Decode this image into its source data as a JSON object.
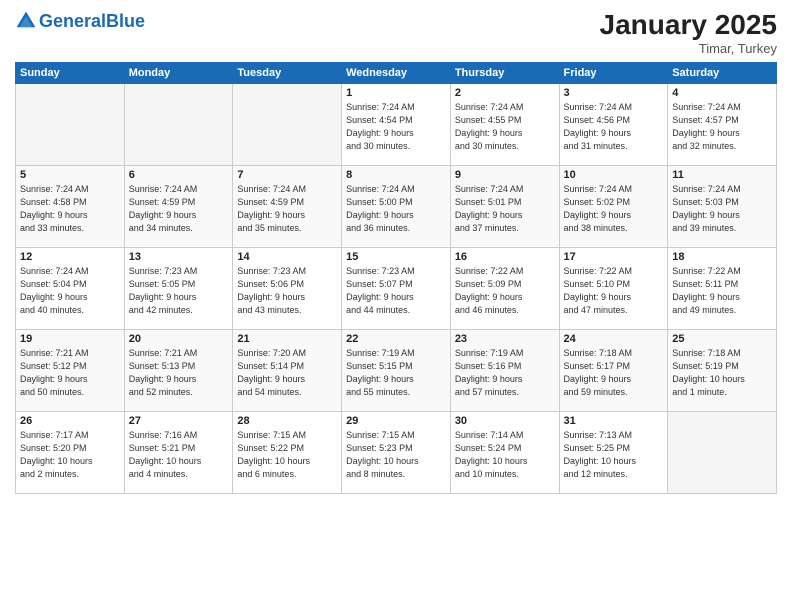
{
  "header": {
    "logo_general": "General",
    "logo_blue": "Blue",
    "month": "January 2025",
    "location": "Timar, Turkey"
  },
  "days_of_week": [
    "Sunday",
    "Monday",
    "Tuesday",
    "Wednesday",
    "Thursday",
    "Friday",
    "Saturday"
  ],
  "weeks": [
    [
      {
        "num": "",
        "info": ""
      },
      {
        "num": "",
        "info": ""
      },
      {
        "num": "",
        "info": ""
      },
      {
        "num": "1",
        "info": "Sunrise: 7:24 AM\nSunset: 4:54 PM\nDaylight: 9 hours\nand 30 minutes."
      },
      {
        "num": "2",
        "info": "Sunrise: 7:24 AM\nSunset: 4:55 PM\nDaylight: 9 hours\nand 30 minutes."
      },
      {
        "num": "3",
        "info": "Sunrise: 7:24 AM\nSunset: 4:56 PM\nDaylight: 9 hours\nand 31 minutes."
      },
      {
        "num": "4",
        "info": "Sunrise: 7:24 AM\nSunset: 4:57 PM\nDaylight: 9 hours\nand 32 minutes."
      }
    ],
    [
      {
        "num": "5",
        "info": "Sunrise: 7:24 AM\nSunset: 4:58 PM\nDaylight: 9 hours\nand 33 minutes."
      },
      {
        "num": "6",
        "info": "Sunrise: 7:24 AM\nSunset: 4:59 PM\nDaylight: 9 hours\nand 34 minutes."
      },
      {
        "num": "7",
        "info": "Sunrise: 7:24 AM\nSunset: 4:59 PM\nDaylight: 9 hours\nand 35 minutes."
      },
      {
        "num": "8",
        "info": "Sunrise: 7:24 AM\nSunset: 5:00 PM\nDaylight: 9 hours\nand 36 minutes."
      },
      {
        "num": "9",
        "info": "Sunrise: 7:24 AM\nSunset: 5:01 PM\nDaylight: 9 hours\nand 37 minutes."
      },
      {
        "num": "10",
        "info": "Sunrise: 7:24 AM\nSunset: 5:02 PM\nDaylight: 9 hours\nand 38 minutes."
      },
      {
        "num": "11",
        "info": "Sunrise: 7:24 AM\nSunset: 5:03 PM\nDaylight: 9 hours\nand 39 minutes."
      }
    ],
    [
      {
        "num": "12",
        "info": "Sunrise: 7:24 AM\nSunset: 5:04 PM\nDaylight: 9 hours\nand 40 minutes."
      },
      {
        "num": "13",
        "info": "Sunrise: 7:23 AM\nSunset: 5:05 PM\nDaylight: 9 hours\nand 42 minutes."
      },
      {
        "num": "14",
        "info": "Sunrise: 7:23 AM\nSunset: 5:06 PM\nDaylight: 9 hours\nand 43 minutes."
      },
      {
        "num": "15",
        "info": "Sunrise: 7:23 AM\nSunset: 5:07 PM\nDaylight: 9 hours\nand 44 minutes."
      },
      {
        "num": "16",
        "info": "Sunrise: 7:22 AM\nSunset: 5:09 PM\nDaylight: 9 hours\nand 46 minutes."
      },
      {
        "num": "17",
        "info": "Sunrise: 7:22 AM\nSunset: 5:10 PM\nDaylight: 9 hours\nand 47 minutes."
      },
      {
        "num": "18",
        "info": "Sunrise: 7:22 AM\nSunset: 5:11 PM\nDaylight: 9 hours\nand 49 minutes."
      }
    ],
    [
      {
        "num": "19",
        "info": "Sunrise: 7:21 AM\nSunset: 5:12 PM\nDaylight: 9 hours\nand 50 minutes."
      },
      {
        "num": "20",
        "info": "Sunrise: 7:21 AM\nSunset: 5:13 PM\nDaylight: 9 hours\nand 52 minutes."
      },
      {
        "num": "21",
        "info": "Sunrise: 7:20 AM\nSunset: 5:14 PM\nDaylight: 9 hours\nand 54 minutes."
      },
      {
        "num": "22",
        "info": "Sunrise: 7:19 AM\nSunset: 5:15 PM\nDaylight: 9 hours\nand 55 minutes."
      },
      {
        "num": "23",
        "info": "Sunrise: 7:19 AM\nSunset: 5:16 PM\nDaylight: 9 hours\nand 57 minutes."
      },
      {
        "num": "24",
        "info": "Sunrise: 7:18 AM\nSunset: 5:17 PM\nDaylight: 9 hours\nand 59 minutes."
      },
      {
        "num": "25",
        "info": "Sunrise: 7:18 AM\nSunset: 5:19 PM\nDaylight: 10 hours\nand 1 minute."
      }
    ],
    [
      {
        "num": "26",
        "info": "Sunrise: 7:17 AM\nSunset: 5:20 PM\nDaylight: 10 hours\nand 2 minutes."
      },
      {
        "num": "27",
        "info": "Sunrise: 7:16 AM\nSunset: 5:21 PM\nDaylight: 10 hours\nand 4 minutes."
      },
      {
        "num": "28",
        "info": "Sunrise: 7:15 AM\nSunset: 5:22 PM\nDaylight: 10 hours\nand 6 minutes."
      },
      {
        "num": "29",
        "info": "Sunrise: 7:15 AM\nSunset: 5:23 PM\nDaylight: 10 hours\nand 8 minutes."
      },
      {
        "num": "30",
        "info": "Sunrise: 7:14 AM\nSunset: 5:24 PM\nDaylight: 10 hours\nand 10 minutes."
      },
      {
        "num": "31",
        "info": "Sunrise: 7:13 AM\nSunset: 5:25 PM\nDaylight: 10 hours\nand 12 minutes."
      },
      {
        "num": "",
        "info": ""
      }
    ]
  ]
}
